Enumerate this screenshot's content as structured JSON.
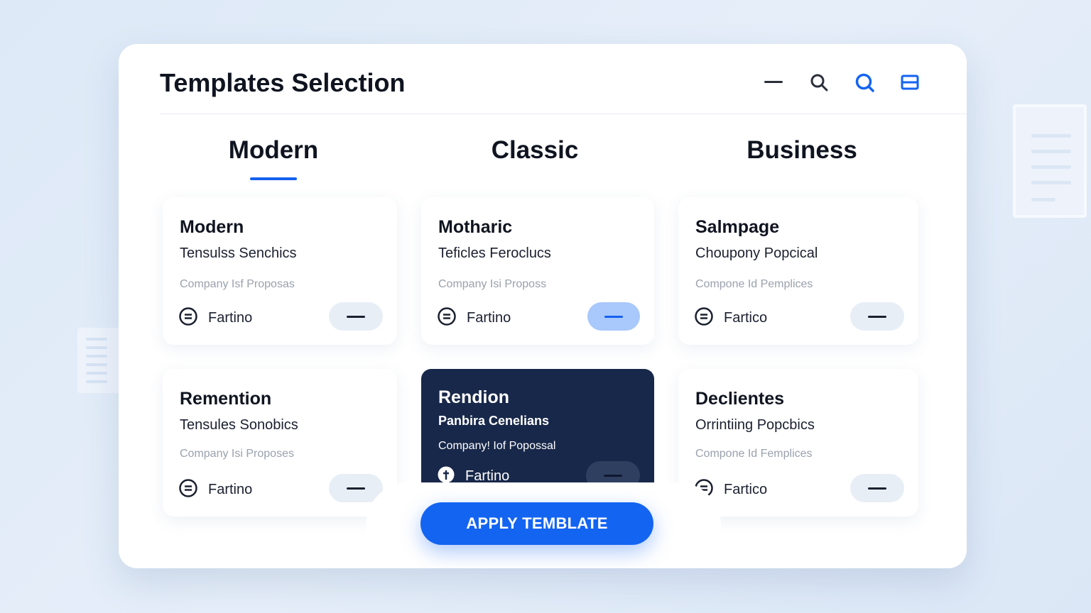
{
  "colors": {
    "accent": "#1464f2",
    "dark_card": "#18284a",
    "active_pill": "#a9c8fb",
    "text": "#0f1420",
    "muted": "#9aa1ad"
  },
  "header": {
    "title": "Templates Selection",
    "icons": [
      "minimize-icon",
      "search-icon",
      "search-active-icon",
      "layout-icon"
    ]
  },
  "tabs": [
    {
      "label": "Modern",
      "active": true
    },
    {
      "label": "Classic",
      "active": false
    },
    {
      "label": "Business",
      "active": false
    }
  ],
  "cards": [
    {
      "title": "Modern",
      "subtitle": "Tensulss Senchics",
      "meta": "Company Isf Proposas",
      "footer": "Fartino",
      "icon": "menu-circle-icon"
    },
    {
      "title": "Motharic",
      "subtitle": "Teficles Feroclucs",
      "meta": "Company Isi Proposs",
      "footer": "Fartino",
      "icon": "menu-circle-icon"
    },
    {
      "title": "Salmpage",
      "subtitle": "Choupony Popcical",
      "meta": "Compone Id Pemplices",
      "footer": "Fartico",
      "icon": "menu-circle-icon"
    },
    {
      "title": "Remention",
      "subtitle": "Tensules Sonobics",
      "meta": "Company Isi Proposes",
      "footer": "Fartino",
      "icon": "menu-circle-icon"
    },
    {
      "title": "Rendion",
      "subtitle": "Panbira Cenelians",
      "meta": "Company! Iof Popossal",
      "footer": "Fartino",
      "icon": "plus-circle-icon"
    },
    {
      "title": "Declientes",
      "subtitle": "Orrintiing Popcbics",
      "meta": "Compone Id Femplices",
      "footer": "Fartico",
      "icon": "menu-circle-icon"
    }
  ],
  "apply_button": "APPLY TEMBLATE"
}
